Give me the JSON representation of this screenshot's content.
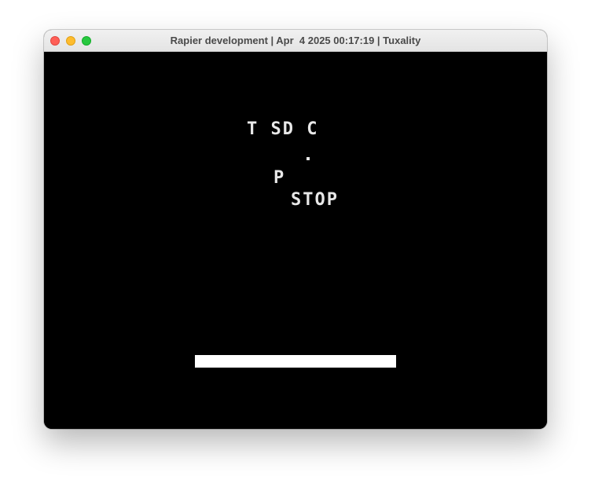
{
  "window": {
    "title": "Rapier development | Apr  4 2025 00:17:19 | Tuxality"
  },
  "game": {
    "text_line_1": "T SD C",
    "text_line_2": ".",
    "text_line_3": "P",
    "text_line_4": "STOP"
  }
}
